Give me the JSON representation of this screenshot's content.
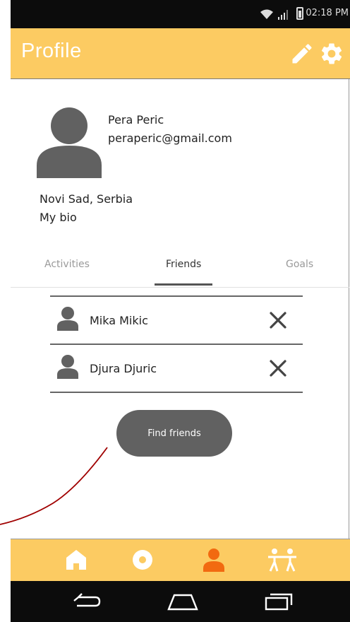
{
  "status_bar": {
    "time": "02:18 PM",
    "icons": [
      "wifi-icon",
      "signal-icon",
      "battery-icon"
    ]
  },
  "app_bar": {
    "title": "Profile",
    "actions": [
      "edit-icon",
      "settings-icon"
    ]
  },
  "profile": {
    "name": "Pera Peric",
    "email": "peraperic@gmail.com",
    "location": "Novi Sad, Serbia",
    "bio": "My bio"
  },
  "tabs": {
    "items": [
      {
        "label": "Activities",
        "active": false
      },
      {
        "label": "Friends",
        "active": true
      },
      {
        "label": "Goals",
        "active": false
      }
    ]
  },
  "friends": [
    {
      "name": "Mika Mikic"
    },
    {
      "name": "Djura Djuric"
    }
  ],
  "actions": {
    "find_friends_label": "Find friends"
  },
  "bottom_nav": {
    "items": [
      "home-icon",
      "activity-icon",
      "profile-icon",
      "friends-icon"
    ],
    "active": "profile-icon"
  },
  "colors": {
    "accent": "#fccb62",
    "active_nav": "#f26a10",
    "icon_white": "#ffffff",
    "avatar_gray": "#616161",
    "button_gray": "#616161",
    "annotation_line": "#a00000"
  }
}
